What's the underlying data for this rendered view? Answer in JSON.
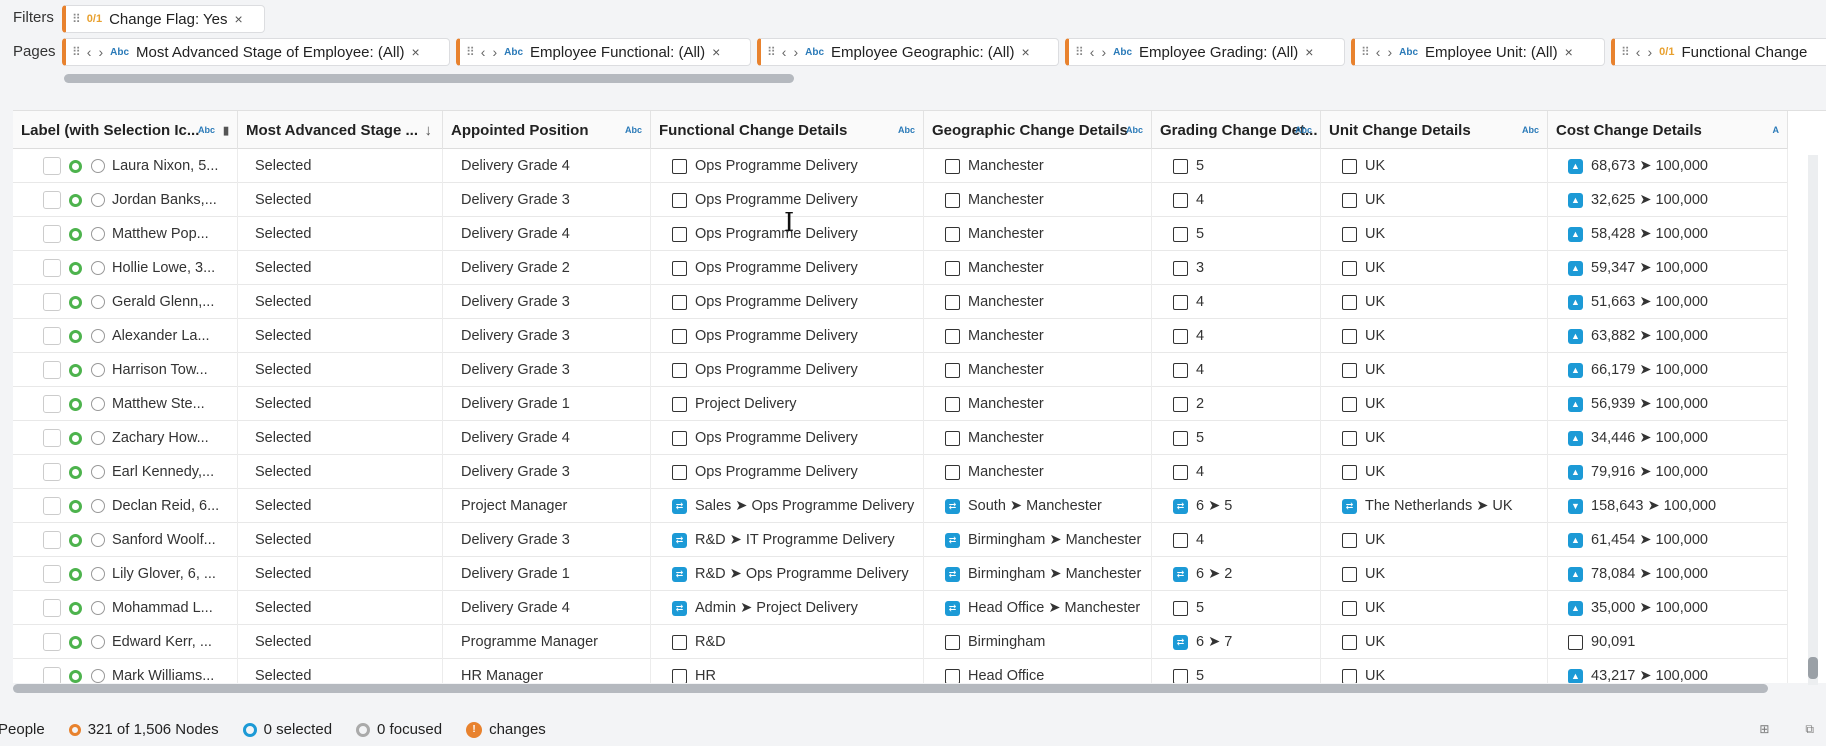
{
  "filters": {
    "label": "Filters",
    "pill_type": "0/1",
    "pill_text": "Change Flag: Yes"
  },
  "pages": {
    "label": "Pages",
    "pills": [
      {
        "type": "Abc",
        "text": "Most Advanced Stage of Employee: (All)"
      },
      {
        "type": "Abc",
        "text": "Employee Functional: (All)"
      },
      {
        "type": "Abc",
        "text": "Employee Geographic: (All)"
      },
      {
        "type": "Abc",
        "text": "Employee Grading: (All)"
      },
      {
        "type": "Abc",
        "text": "Employee Unit: (All)"
      },
      {
        "type": "0/1",
        "text": "Functional Change"
      }
    ]
  },
  "table": {
    "columns": [
      {
        "label": "Label (with Selection Ic...",
        "badge": "Abc"
      },
      {
        "label": "Most Advanced Stage ...",
        "badge": "sort-desc"
      },
      {
        "label": "Appointed Position",
        "badge": "Abc"
      },
      {
        "label": "Functional Change Details",
        "badge": "Abc"
      },
      {
        "label": "Geographic Change Details",
        "badge": "Abc"
      },
      {
        "label": "Grading Change Det...",
        "badge": "Abc"
      },
      {
        "label": "Unit Change Details",
        "badge": "Abc"
      },
      {
        "label": "Cost Change Details",
        "badge": "A"
      }
    ],
    "rows": [
      {
        "label": "Laura Nixon, 5...",
        "stage": "Selected",
        "position": "Delivery Grade 4",
        "func": "Ops Programme Delivery",
        "func_changed": false,
        "geo": "Manchester",
        "geo_changed": false,
        "grade": "5",
        "grade_changed": false,
        "unit": "UK",
        "unit_changed": false,
        "cost": "68,673 ➤ 100,000",
        "cost_dir": "up"
      },
      {
        "label": "Jordan Banks,...",
        "stage": "Selected",
        "position": "Delivery Grade 3",
        "func": "Ops Programme Delivery",
        "func_changed": false,
        "geo": "Manchester",
        "geo_changed": false,
        "grade": "4",
        "grade_changed": false,
        "unit": "UK",
        "unit_changed": false,
        "cost": "32,625 ➤ 100,000",
        "cost_dir": "up"
      },
      {
        "label": "Matthew Pop...",
        "stage": "Selected",
        "position": "Delivery Grade 4",
        "func": "Ops Programme Delivery",
        "func_changed": false,
        "geo": "Manchester",
        "geo_changed": false,
        "grade": "5",
        "grade_changed": false,
        "unit": "UK",
        "unit_changed": false,
        "cost": "58,428 ➤ 100,000",
        "cost_dir": "up"
      },
      {
        "label": "Hollie Lowe, 3...",
        "stage": "Selected",
        "position": "Delivery Grade 2",
        "func": "Ops Programme Delivery",
        "func_changed": false,
        "geo": "Manchester",
        "geo_changed": false,
        "grade": "3",
        "grade_changed": false,
        "unit": "UK",
        "unit_changed": false,
        "cost": "59,347 ➤ 100,000",
        "cost_dir": "up"
      },
      {
        "label": "Gerald Glenn,...",
        "stage": "Selected",
        "position": "Delivery Grade 3",
        "func": "Ops Programme Delivery",
        "func_changed": false,
        "geo": "Manchester",
        "geo_changed": false,
        "grade": "4",
        "grade_changed": false,
        "unit": "UK",
        "unit_changed": false,
        "cost": "51,663 ➤ 100,000",
        "cost_dir": "up"
      },
      {
        "label": "Alexander La...",
        "stage": "Selected",
        "position": "Delivery Grade 3",
        "func": "Ops Programme Delivery",
        "func_changed": false,
        "geo": "Manchester",
        "geo_changed": false,
        "grade": "4",
        "grade_changed": false,
        "unit": "UK",
        "unit_changed": false,
        "cost": "63,882 ➤ 100,000",
        "cost_dir": "up"
      },
      {
        "label": "Harrison Tow...",
        "stage": "Selected",
        "position": "Delivery Grade 3",
        "func": "Ops Programme Delivery",
        "func_changed": false,
        "geo": "Manchester",
        "geo_changed": false,
        "grade": "4",
        "grade_changed": false,
        "unit": "UK",
        "unit_changed": false,
        "cost": "66,179 ➤ 100,000",
        "cost_dir": "up"
      },
      {
        "label": "Matthew Ste...",
        "stage": "Selected",
        "position": "Delivery Grade 1",
        "func": "Project Delivery",
        "func_changed": false,
        "geo": "Manchester",
        "geo_changed": false,
        "grade": "2",
        "grade_changed": false,
        "unit": "UK",
        "unit_changed": false,
        "cost": "56,939 ➤ 100,000",
        "cost_dir": "up"
      },
      {
        "label": "Zachary How...",
        "stage": "Selected",
        "position": "Delivery Grade 4",
        "func": "Ops Programme Delivery",
        "func_changed": false,
        "geo": "Manchester",
        "geo_changed": false,
        "grade": "5",
        "grade_changed": false,
        "unit": "UK",
        "unit_changed": false,
        "cost": "34,446 ➤ 100,000",
        "cost_dir": "up"
      },
      {
        "label": "Earl Kennedy,...",
        "stage": "Selected",
        "position": "Delivery Grade 3",
        "func": "Ops Programme Delivery",
        "func_changed": false,
        "geo": "Manchester",
        "geo_changed": false,
        "grade": "4",
        "grade_changed": false,
        "unit": "UK",
        "unit_changed": false,
        "cost": "79,916 ➤ 100,000",
        "cost_dir": "up"
      },
      {
        "label": "Declan Reid, 6...",
        "stage": "Selected",
        "position": "Project Manager",
        "func": "Sales ➤ Ops Programme Delivery",
        "func_changed": true,
        "geo": "South ➤ Manchester",
        "geo_changed": true,
        "grade": "6 ➤ 5",
        "grade_changed": true,
        "unit": "The Netherlands ➤ UK",
        "unit_changed": true,
        "cost": "158,643 ➤ 100,000",
        "cost_dir": "down"
      },
      {
        "label": "Sanford Woolf...",
        "stage": "Selected",
        "position": "Delivery Grade 3",
        "func": "R&D ➤ IT Programme Delivery",
        "func_changed": true,
        "geo": "Birmingham ➤ Manchester",
        "geo_changed": true,
        "grade": "4",
        "grade_changed": false,
        "unit": "UK",
        "unit_changed": false,
        "cost": "61,454 ➤ 100,000",
        "cost_dir": "up"
      },
      {
        "label": "Lily Glover, 6, ...",
        "stage": "Selected",
        "position": "Delivery Grade 1",
        "func": "R&D ➤ Ops Programme Delivery",
        "func_changed": true,
        "geo": "Birmingham ➤ Manchester",
        "geo_changed": true,
        "grade": "6 ➤ 2",
        "grade_changed": true,
        "unit": "UK",
        "unit_changed": false,
        "cost": "78,084 ➤ 100,000",
        "cost_dir": "up"
      },
      {
        "label": "Mohammad L...",
        "stage": "Selected",
        "position": "Delivery Grade 4",
        "func": "Admin ➤ Project Delivery",
        "func_changed": true,
        "geo": "Head Office ➤ Manchester",
        "geo_changed": true,
        "grade": "5",
        "grade_changed": false,
        "unit": "UK",
        "unit_changed": false,
        "cost": "35,000 ➤ 100,000",
        "cost_dir": "up"
      },
      {
        "label": "Edward Kerr, ...",
        "stage": "Selected",
        "position": "Programme Manager",
        "func": "R&D",
        "func_changed": false,
        "geo": "Birmingham",
        "geo_changed": false,
        "grade": "6 ➤ 7",
        "grade_changed": true,
        "unit": "UK",
        "unit_changed": false,
        "cost": "90,091",
        "cost_dir": "none"
      },
      {
        "label": "Mark Williams...",
        "stage": "Selected",
        "position": "HR Manager",
        "func": "HR",
        "func_changed": false,
        "geo": "Head Office",
        "geo_changed": false,
        "grade": "5",
        "grade_changed": false,
        "unit": "UK",
        "unit_changed": false,
        "cost": "43,217 ➤ 100,000",
        "cost_dir": "up"
      }
    ]
  },
  "status": {
    "view": "People",
    "nodes": "321 of 1,506 Nodes",
    "selected": "0 selected",
    "focused": "0 focused",
    "changes_count": "!",
    "changes": "changes"
  }
}
